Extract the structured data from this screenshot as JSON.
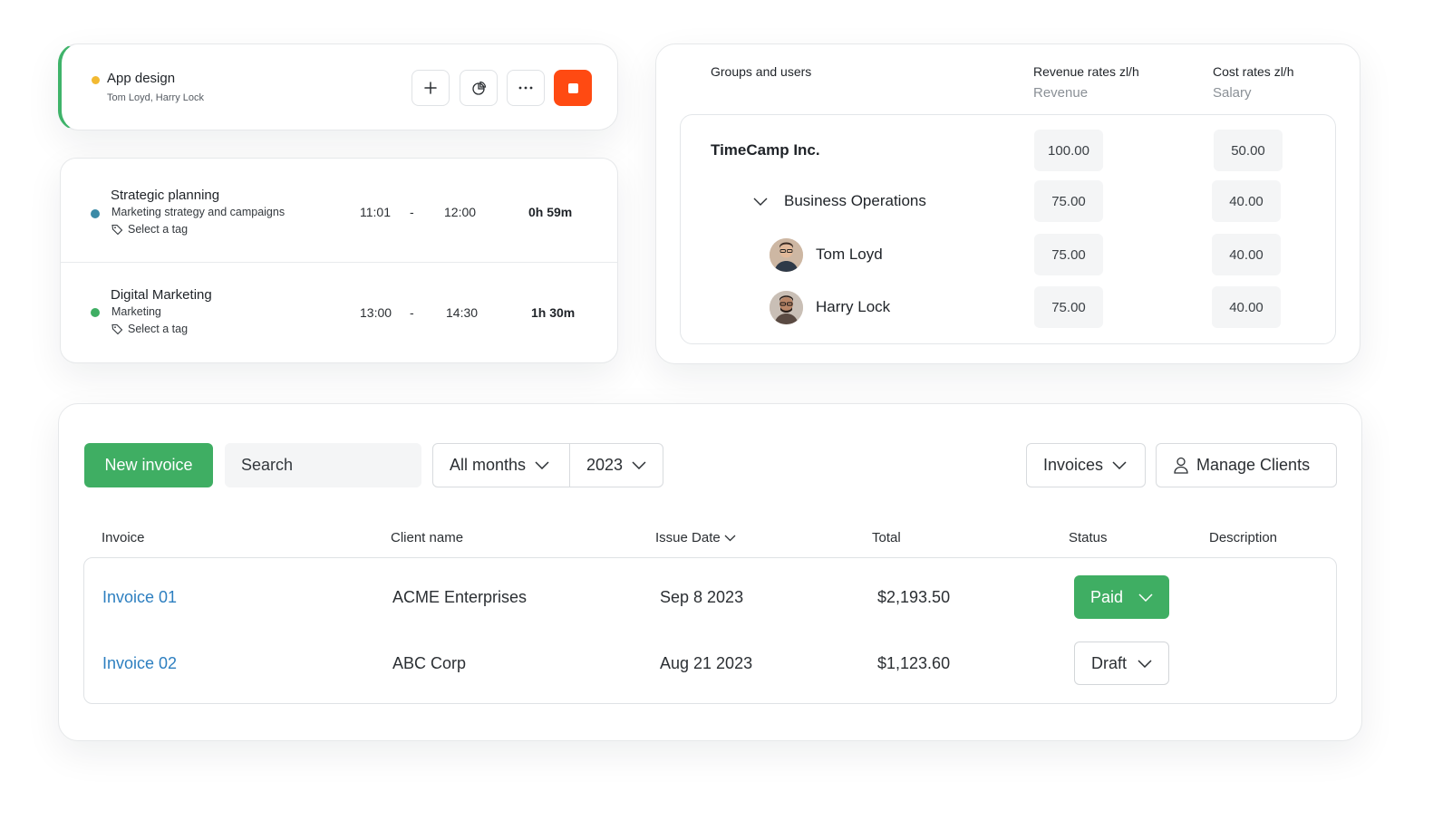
{
  "timer": {
    "title": "App design",
    "users": "Tom Loyd, Harry Lock",
    "dot_color": "#f2b931",
    "accent_color": "#3fb36a",
    "stop_color": "#ff4a12",
    "icons": [
      "plus-icon",
      "chart-pie-icon",
      "more-icon",
      "stop-icon"
    ]
  },
  "entries": [
    {
      "title": "Strategic planning",
      "description": "Marketing strategy and campaigns",
      "tag": "Select a tag",
      "start": "11:01",
      "separator": "-",
      "end": "12:00",
      "duration": "0h 59m",
      "dot_color": "#3a8aa6"
    },
    {
      "title": "Digital Marketing",
      "description": "Marketing",
      "tag": "Select a tag",
      "start": "13:00",
      "separator": "-",
      "end": "14:30",
      "duration": "1h 30m",
      "dot_color": "#3fae63"
    }
  ],
  "rates": {
    "col_groups": "Groups and users",
    "col_revenue": "Revenue rates zl/h",
    "col_revenue_sub": "Revenue",
    "col_cost": "Cost rates zl/h",
    "col_cost_sub": "Salary",
    "rows": [
      {
        "label": "TimeCamp Inc.",
        "revenue": "100.00",
        "cost": "50.00"
      },
      {
        "label": "Business Operations",
        "revenue": "75.00",
        "cost": "40.00"
      },
      {
        "label": "Tom Loyd",
        "revenue": "75.00",
        "cost": "40.00"
      },
      {
        "label": "Harry Lock",
        "revenue": "75.00",
        "cost": "40.00"
      }
    ]
  },
  "invoices": {
    "new_button": "New invoice",
    "search_placeholder": "Search",
    "months_filter": "All months",
    "year_filter": "2023",
    "type_filter": "Invoices",
    "manage_clients": "Manage Clients",
    "columns": {
      "invoice": "Invoice",
      "client": "Client name",
      "issue_date": "Issue Date",
      "total": "Total",
      "status": "Status",
      "description": "Description"
    },
    "rows": [
      {
        "invoice": "Invoice 01",
        "client": "ACME Enterprises",
        "issue_date": "Sep 8 2023",
        "total": "$2,193.50",
        "status": "Paid"
      },
      {
        "invoice": "Invoice 02",
        "client": "ABC Corp",
        "issue_date": "Aug 21 2023",
        "total": "$1,123.60",
        "status": "Draft"
      }
    ],
    "primary_color": "#3fae63",
    "link_color": "#2d7fc0"
  }
}
